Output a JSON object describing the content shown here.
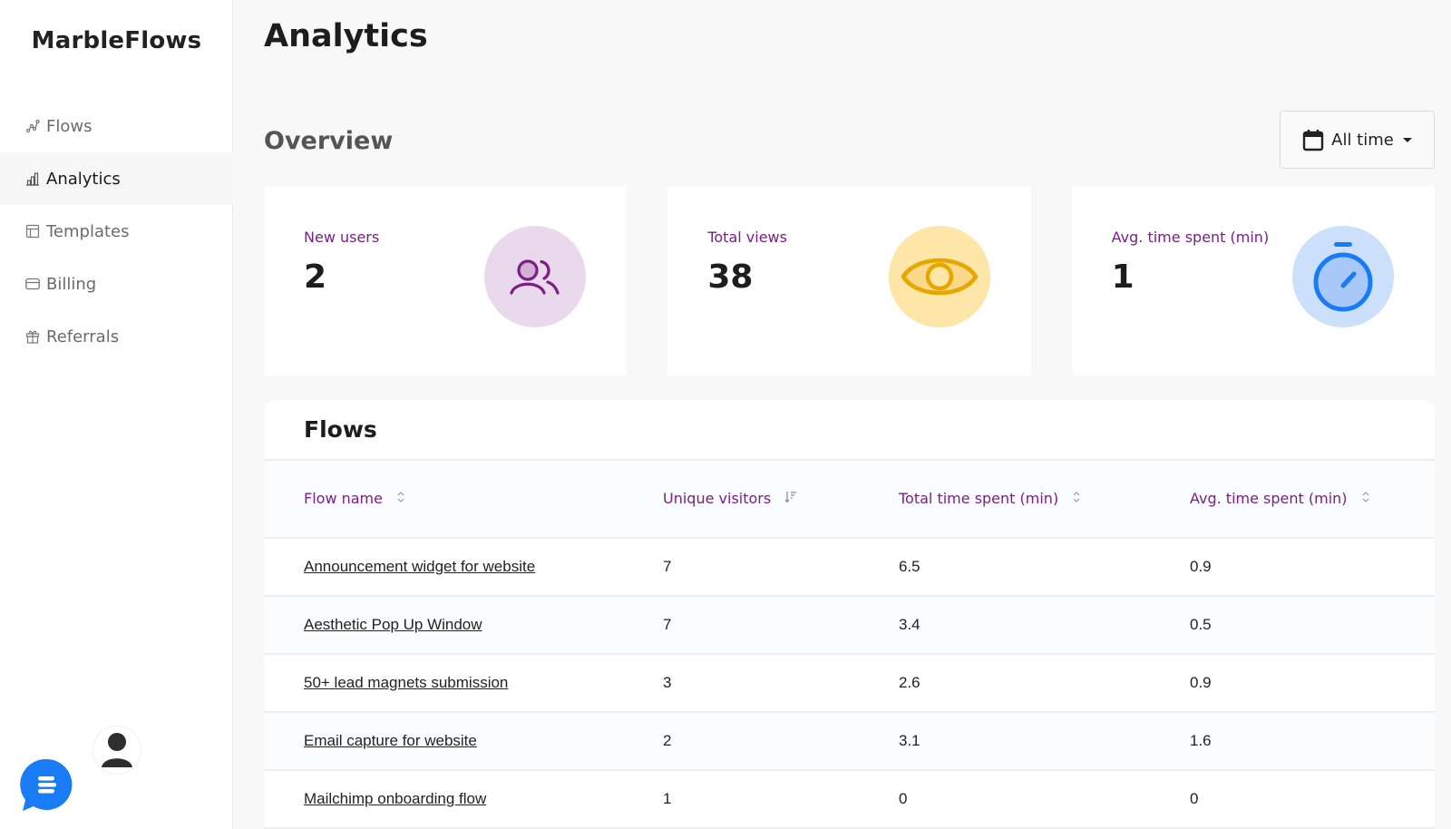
{
  "app": {
    "name": "MarbleFlows"
  },
  "sidebar": {
    "items": [
      {
        "label": "Flows",
        "icon": "flows-icon",
        "active": false
      },
      {
        "label": "Analytics",
        "icon": "bar-chart-icon",
        "active": true
      },
      {
        "label": "Templates",
        "icon": "layout-icon",
        "active": false
      },
      {
        "label": "Billing",
        "icon": "credit-card-icon",
        "active": false
      },
      {
        "label": "Referrals",
        "icon": "gift-icon",
        "active": false
      }
    ]
  },
  "header": {
    "title": "Analytics"
  },
  "overview": {
    "title": "Overview",
    "date_filter": {
      "selected": "All time"
    },
    "cards": [
      {
        "label": "New users",
        "value": "2",
        "icon": "users-icon",
        "color": "#7b1f86",
        "bg": "#ead9ec"
      },
      {
        "label": "Total views",
        "value": "38",
        "icon": "eye-icon",
        "color": "#e5a800",
        "bg": "#fde6a8"
      },
      {
        "label": "Avg. time spent (min)",
        "value": "1",
        "icon": "stopwatch-icon",
        "color": "#1a7cf5",
        "bg": "#cde0fb"
      }
    ]
  },
  "flows_table": {
    "title": "Flows",
    "columns": [
      {
        "label": "Flow name",
        "sort": "none"
      },
      {
        "label": "Unique visitors",
        "sort": "desc"
      },
      {
        "label": "Total time spent (min)",
        "sort": "none"
      },
      {
        "label": "Avg. time spent (min)",
        "sort": "none"
      }
    ],
    "rows": [
      {
        "name": "Announcement widget for website",
        "visitors": "7",
        "total": "6.5",
        "avg": "0.9"
      },
      {
        "name": "Aesthetic Pop Up Window",
        "visitors": "7",
        "total": "3.4",
        "avg": "0.5"
      },
      {
        "name": "50+ lead magnets submission",
        "visitors": "3",
        "total": "2.6",
        "avg": "0.9"
      },
      {
        "name": "Email capture for website",
        "visitors": "2",
        "total": "3.1",
        "avg": "1.6"
      },
      {
        "name": "Mailchimp onboarding flow",
        "visitors": "1",
        "total": "0",
        "avg": "0"
      }
    ]
  },
  "colors": {
    "accent": "#7b1f86",
    "chat": "#1a7cf5"
  }
}
